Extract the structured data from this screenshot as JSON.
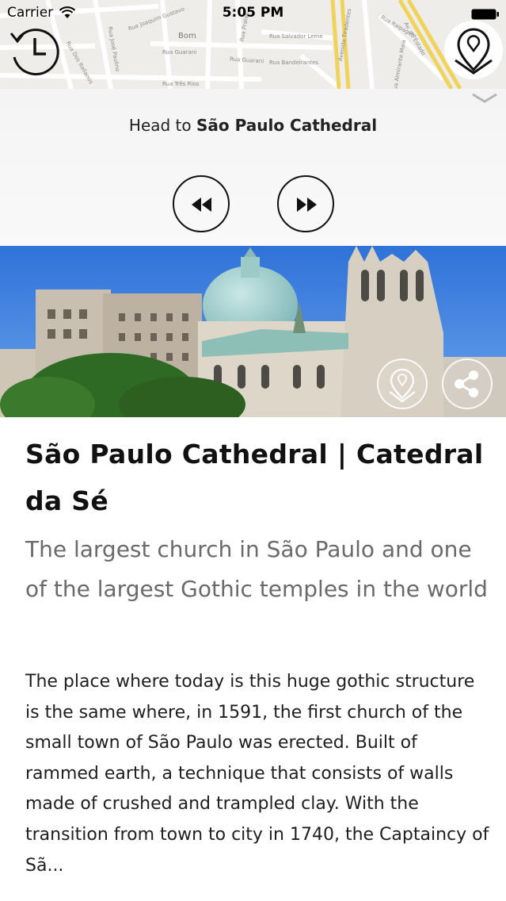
{
  "status_bar": {
    "carrier": "Carrier",
    "time": "5:05 PM"
  },
  "map": {
    "streets": [
      "Rua Joaquim Gustavo",
      "Rua Guarani",
      "Rua Dos Italianos",
      "Rua José Paulino",
      "Rua Três Rios",
      "Rua Prates",
      "Rua Salvador Leme",
      "Rua Bandeirantes",
      "Avenida Tiradentes",
      "Rua Almirante Maia",
      "Avenida Cruzeiro",
      "Rua Itaipagem",
      "Av. do Estado",
      "Bom",
      "Rua Guarani",
      "Rua Afonso Pena"
    ]
  },
  "navigation": {
    "instruction_prefix": "Head to ",
    "destination": "São Paulo Cathedral"
  },
  "icons": {
    "timer": "timer-icon",
    "location_pin": "location-pin-icon",
    "collapse": "chevron-down-icon",
    "rewind": "rewind-icon",
    "fast_forward": "fast-forward-icon",
    "share": "share-icon"
  },
  "content": {
    "title": "São Paulo Cathedral | Catedral da Sé",
    "subtitle": "The largest church in São Paulo and one of the largest Gothic temples in the world",
    "body": "The place where today is this huge gothic structure is the same where, in 1591, the first church of the small town of São Paulo was erected. Built of rammed earth, a technique that consists of walls made of crushed and trampled clay. With the transition from town to city in 1740, the Captaincy of Sã..."
  },
  "colors": {
    "accent": "#111111",
    "sky": "#3d7fe0",
    "dome": "#9fcfcf"
  }
}
